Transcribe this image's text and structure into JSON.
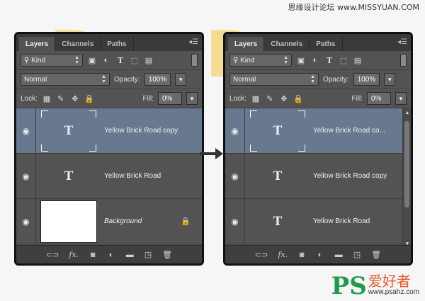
{
  "watermark_top": "思缘设计论坛 www.MISSYUAN.COM",
  "watermark_bottom": {
    "logo": "PS",
    "cn": "爱好者",
    "url": "www.psahz.com"
  },
  "panels": [
    {
      "tabs": [
        "Layers",
        "Channels",
        "Paths"
      ],
      "filter_kind": "Kind",
      "blend_mode": "Normal",
      "opacity_label": "Opacity:",
      "opacity_value": "100%",
      "lock_label": "Lock:",
      "fill_label": "Fill:",
      "fill_value": "0%",
      "layers": [
        {
          "name": "Yellow Brick Road copy",
          "type": "text",
          "selected": true
        },
        {
          "name": "Yellow Brick Road",
          "type": "text",
          "selected": false
        },
        {
          "name": "Background",
          "type": "image",
          "locked": true
        }
      ]
    },
    {
      "tabs": [
        "Layers",
        "Channels",
        "Paths"
      ],
      "filter_kind": "Kind",
      "blend_mode": "Normal",
      "opacity_label": "Opacity:",
      "opacity_value": "100%",
      "lock_label": "Lock:",
      "fill_label": "Fill:",
      "fill_value": "0%",
      "layers": [
        {
          "name": "Yellow Brick Road co...",
          "type": "text",
          "selected": true
        },
        {
          "name": "Yellow Brick Road copy",
          "type": "text",
          "selected": false
        },
        {
          "name": "Yellow Brick Road",
          "type": "text",
          "selected": false
        }
      ]
    }
  ],
  "colors": {
    "panel_bg": "#535353",
    "selected_layer": "#67788f",
    "background_letters": "#f3d46d"
  }
}
